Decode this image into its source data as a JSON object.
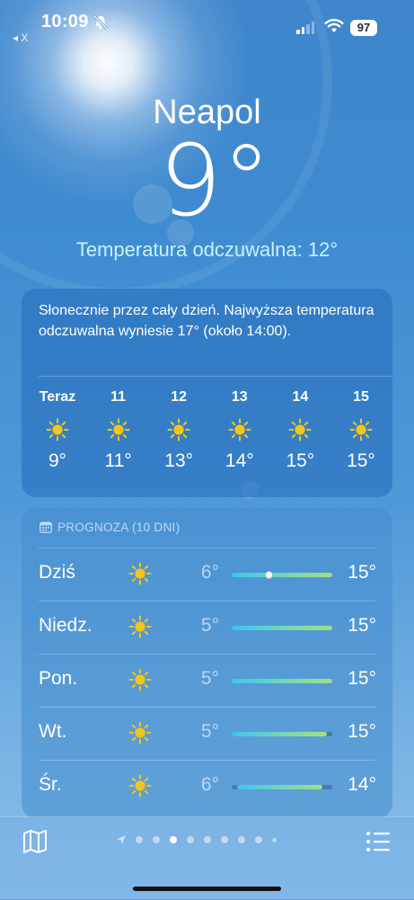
{
  "status_bar": {
    "time": "10:09",
    "battery": "97",
    "back_label": "◂ X",
    "signal_bars": 2,
    "mute_icon": "bell-slash-icon",
    "wifi_icon": "wifi-icon"
  },
  "location": {
    "city": "Neapol",
    "temperature": "9°",
    "feels_like": "Temperatura odczuwalna: 12°"
  },
  "hourly": {
    "summary": "Słonecznie przez cały dzień. Najwyższa temperatura odczuwalna wyniesie 17° (około 14:00).",
    "hours": [
      {
        "label": "Teraz",
        "icon": "sun-icon",
        "temp": "9°"
      },
      {
        "label": "11",
        "icon": "sun-icon",
        "temp": "11°"
      },
      {
        "label": "12",
        "icon": "sun-icon",
        "temp": "13°"
      },
      {
        "label": "13",
        "icon": "sun-icon",
        "temp": "14°"
      },
      {
        "label": "14",
        "icon": "sun-icon",
        "temp": "15°"
      },
      {
        "label": "15",
        "icon": "sun-icon",
        "temp": "15°"
      }
    ]
  },
  "forecast": {
    "header": "PROGNOZA (10 DNI)",
    "days": [
      {
        "day": "Dziś",
        "icon": "sun-icon",
        "low": "6°",
        "high": "15°",
        "bar_start": 0.0,
        "bar_end": 1.0,
        "current_marker": 0.37
      },
      {
        "day": "Niedz.",
        "icon": "sun-icon",
        "low": "5°",
        "high": "15°",
        "bar_start": 0.0,
        "bar_end": 1.0
      },
      {
        "day": "Pon.",
        "icon": "sun-icon",
        "low": "5°",
        "high": "15°",
        "bar_start": 0.0,
        "bar_end": 1.0
      },
      {
        "day": "Wt.",
        "icon": "sun-icon",
        "low": "5°",
        "high": "15°",
        "bar_start": 0.0,
        "bar_end": 0.95
      },
      {
        "day": "Śr.",
        "icon": "sun-icon",
        "low": "6°",
        "high": "14°",
        "bar_start": 0.05,
        "bar_end": 0.9
      }
    ]
  },
  "bottom_bar": {
    "page_count": 10,
    "active_page": 3,
    "map_icon": "map-icon",
    "list_icon": "list-icon"
  },
  "colors": {
    "feels_like": "#c6f2ff",
    "sun": "#f5c518"
  }
}
